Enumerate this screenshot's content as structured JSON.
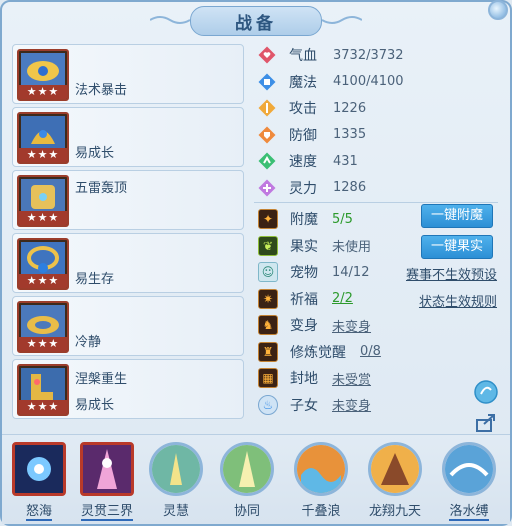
{
  "window": {
    "title": "战备"
  },
  "equipment": [
    {
      "name": "法术暴击",
      "stars": "★★★"
    },
    {
      "name": "易成长",
      "stars": "★★★"
    },
    {
      "name": "五雷轰顶",
      "stars": "★★★"
    },
    {
      "name": "易生存",
      "stars": "★★★"
    },
    {
      "name": "冷静",
      "stars": "★★★"
    },
    {
      "name": "涅槃重生",
      "name2": "易成长",
      "stars": "★★★"
    }
  ],
  "stats": [
    {
      "label": "气血",
      "value": "3732/3732",
      "icon": "heart-icon",
      "color": "#e0566a"
    },
    {
      "label": "魔法",
      "value": "4100/4100",
      "icon": "mana-icon",
      "color": "#3d8fe6"
    },
    {
      "label": "攻击",
      "value": "1226",
      "icon": "attack-icon",
      "color": "#f0a93a"
    },
    {
      "label": "防御",
      "value": "1335",
      "icon": "defense-icon",
      "color": "#ef8a3c"
    },
    {
      "label": "速度",
      "value": "431",
      "icon": "speed-icon",
      "color": "#3bbf74"
    },
    {
      "label": "灵力",
      "value": "1286",
      "icon": "spirit-icon",
      "color": "#c07ae0"
    }
  ],
  "extras": {
    "enchant": {
      "label": "附魔",
      "value": "5/5",
      "button": "一键附魔"
    },
    "fruit": {
      "label": "果实",
      "value": "未使用",
      "button": "一键果实"
    },
    "pet": {
      "label": "宠物",
      "value": "14/12",
      "link": "赛事不生效预设"
    },
    "pray": {
      "label": "祈福",
      "value": "2/2",
      "link": "状态生效规则"
    },
    "transform": {
      "label": "变身",
      "value": "未变身"
    },
    "cultivate": {
      "label": "修炼觉醒",
      "value": "0/8"
    },
    "land": {
      "label": "封地",
      "value": "未受赏"
    },
    "children": {
      "label": "子女",
      "value": "未变身"
    }
  },
  "skills": [
    {
      "label": "怒海",
      "style": "square"
    },
    {
      "label": "灵贯三界",
      "style": "square"
    },
    {
      "label": "灵慧",
      "style": "round"
    },
    {
      "label": "协同",
      "style": "round"
    },
    {
      "label": "千叠浪",
      "style": "round"
    },
    {
      "label": "龙翔九天",
      "style": "round"
    },
    {
      "label": "洛水缚",
      "style": "round"
    }
  ],
  "colors": {
    "accent": "#2c8fd5",
    "value_green": "#2c9a2c",
    "text": "#2f4d6b"
  }
}
